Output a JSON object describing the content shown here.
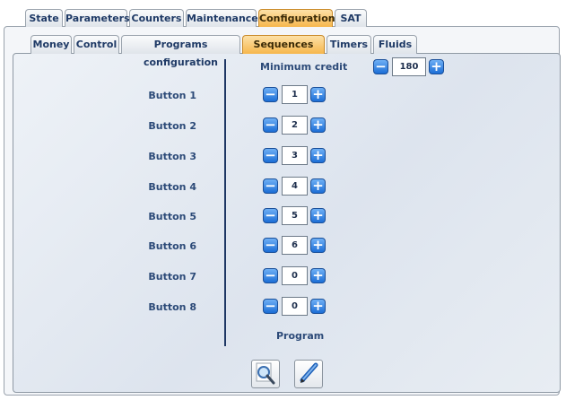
{
  "main_tabs": [
    "State",
    "Parameters",
    "Counters",
    "Maintenance",
    "Configuration",
    "SAT"
  ],
  "sub_tabs": [
    "Money",
    "Control",
    "Programs configuration",
    "Sequences",
    "Timers",
    "Fluids"
  ],
  "min_credit": {
    "label": "Minimum credit",
    "value": "180"
  },
  "buttons": [
    {
      "label": "Button 1",
      "value": "1"
    },
    {
      "label": "Button 2",
      "value": "2"
    },
    {
      "label": "Button 3",
      "value": "3"
    },
    {
      "label": "Button 4",
      "value": "4"
    },
    {
      "label": "Button 5",
      "value": "5"
    },
    {
      "label": "Button 6",
      "value": "6"
    },
    {
      "label": "Button 7",
      "value": "0"
    },
    {
      "label": "Button 8",
      "value": "0"
    }
  ],
  "program_label": "Program",
  "controls": {
    "minus_symbol": "−",
    "plus_symbol": "+"
  },
  "icons": {
    "search": "magnifier-icon",
    "edit": "pen-icon"
  },
  "colors": {
    "accent_tab": "#f6b64c",
    "stepper_blue": "#1c6ed6",
    "label_text": "#2c4a78"
  }
}
